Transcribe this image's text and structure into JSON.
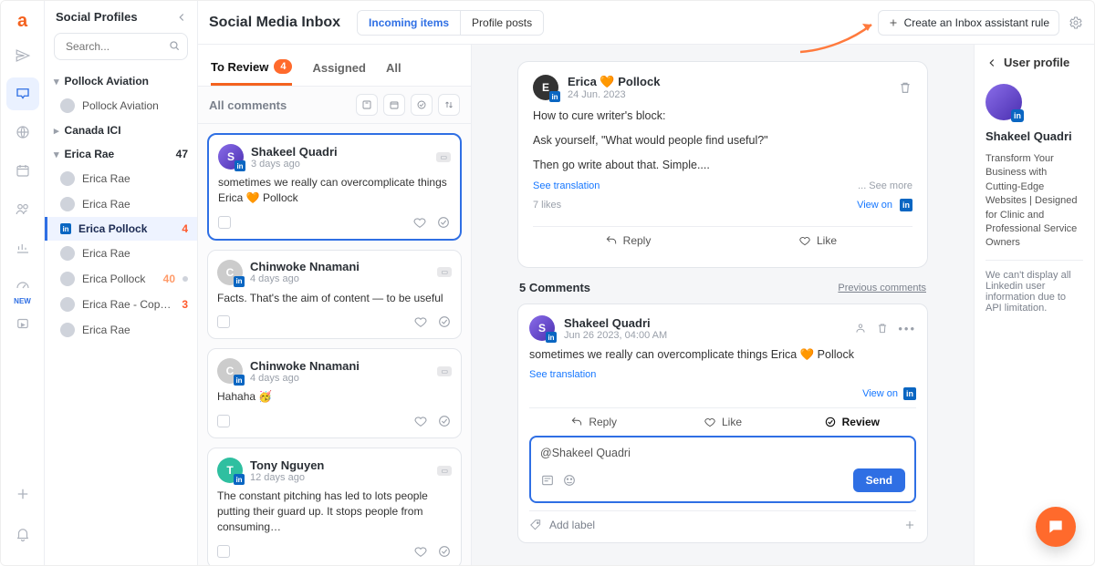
{
  "header": {
    "title": "Social Media Inbox",
    "seg": {
      "incoming": "Incoming items",
      "posts": "Profile posts"
    },
    "create_rule": "Create an Inbox assistant rule"
  },
  "profiles": {
    "title": "Social Profiles",
    "search_placeholder": "Search...",
    "groups": [
      {
        "name": "Pollock Aviation",
        "open": true,
        "items": [
          {
            "name": "Pollock Aviation"
          }
        ]
      },
      {
        "name": "Canada ICI",
        "open": false
      },
      {
        "name": "Erica Rae",
        "open": true,
        "count": "47",
        "items": [
          {
            "name": "Erica Rae"
          },
          {
            "name": "Erica Rae"
          },
          {
            "name": "Erica Pollock",
            "count": "4",
            "active": true,
            "net": "linkedin"
          },
          {
            "name": "Erica Rae"
          },
          {
            "name": "Erica Pollock",
            "count": "40",
            "grey": true
          },
          {
            "name": "Erica Rae - Copywriter ...",
            "count": "3"
          },
          {
            "name": "Erica Rae"
          }
        ]
      }
    ]
  },
  "tabs": {
    "to_review": "To Review",
    "to_review_count": "4",
    "assigned": "Assigned",
    "all": "All"
  },
  "list": {
    "header": "All comments",
    "cards": [
      {
        "name": "Shakeel Quadri",
        "when": "3 days ago",
        "body": "sometimes we really can overcomplicate things Erica 🧡 Pollock",
        "selected": true
      },
      {
        "name": "Chinwoke Nnamani",
        "when": "4 days ago",
        "body": "Facts. That's the aim of content — to be useful"
      },
      {
        "name": "Chinwoke Nnamani",
        "when": "4 days ago",
        "body": "Hahaha 🥳"
      },
      {
        "name": "Tony Nguyen",
        "when": "12 days ago",
        "body": "The constant pitching has led to lots people putting their guard up. It stops people from consuming…"
      }
    ]
  },
  "post": {
    "author": "Erica 🧡 Pollock",
    "date": "24 Jun. 2023",
    "lines": [
      "How to cure writer's block:",
      "Ask yourself, \"What would people find useful?\"",
      "Then go write about that. Simple...."
    ],
    "see_translation": "See translation",
    "see_more": "... See more",
    "likes": "7 likes",
    "view_on": "View on",
    "reply": "Reply",
    "like": "Like"
  },
  "comments": {
    "heading": "5 Comments",
    "prev": "Previous comments"
  },
  "comment": {
    "author": "Shakeel Quadri",
    "when": "Jun 26 2023, 04:00 AM",
    "body": "sometimes we really can overcomplicate things Erica 🧡 Pollock",
    "see_translation": "See translation",
    "view_on": "View on",
    "reply": "Reply",
    "like": "Like",
    "review": "Review"
  },
  "reply": {
    "text": "@Shakeel Quadri",
    "send": "Send",
    "add_label": "Add label"
  },
  "profile_panel": {
    "title": "User profile",
    "name": "Shakeel Quadri",
    "bio": "Transform Your Business with Cutting-Edge Websites | Designed for Clinic and Professional Service Owners",
    "note": "We can't display all Linkedin user information due to API limitation."
  },
  "rail_new": "NEW"
}
